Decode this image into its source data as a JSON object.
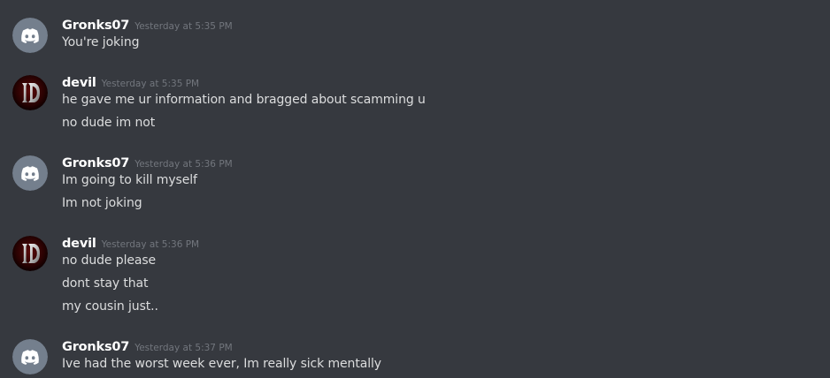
{
  "messages": [
    {
      "author": "Gronks07",
      "avatar": "discord-default-avatar",
      "timestamp": "Yesterday at 5:35 PM",
      "lines": [
        "You're joking"
      ]
    },
    {
      "author": "devil",
      "avatar": "devil-avatar",
      "timestamp": "Yesterday at 5:35 PM",
      "lines": [
        "he gave me ur information and bragged about scamming u",
        "no dude im not"
      ]
    },
    {
      "author": "Gronks07",
      "avatar": "discord-default-avatar",
      "timestamp": "Yesterday at 5:36 PM",
      "lines": [
        "Im going to kill myself",
        "Im not joking"
      ]
    },
    {
      "author": "devil",
      "avatar": "devil-avatar",
      "timestamp": "Yesterday at 5:36 PM",
      "lines": [
        "no dude please",
        "dont stay that",
        "my cousin just.."
      ]
    },
    {
      "author": "Gronks07",
      "avatar": "discord-default-avatar",
      "timestamp": "Yesterday at 5:37 PM",
      "lines": [
        "Ive had the worst week ever, Im really sick mentally"
      ]
    }
  ],
  "colors": {
    "background": "#36393f",
    "username": "#ffffff",
    "timestamp": "#72767d",
    "message_text": "#dcddde",
    "default_avatar": "#747f8d"
  }
}
